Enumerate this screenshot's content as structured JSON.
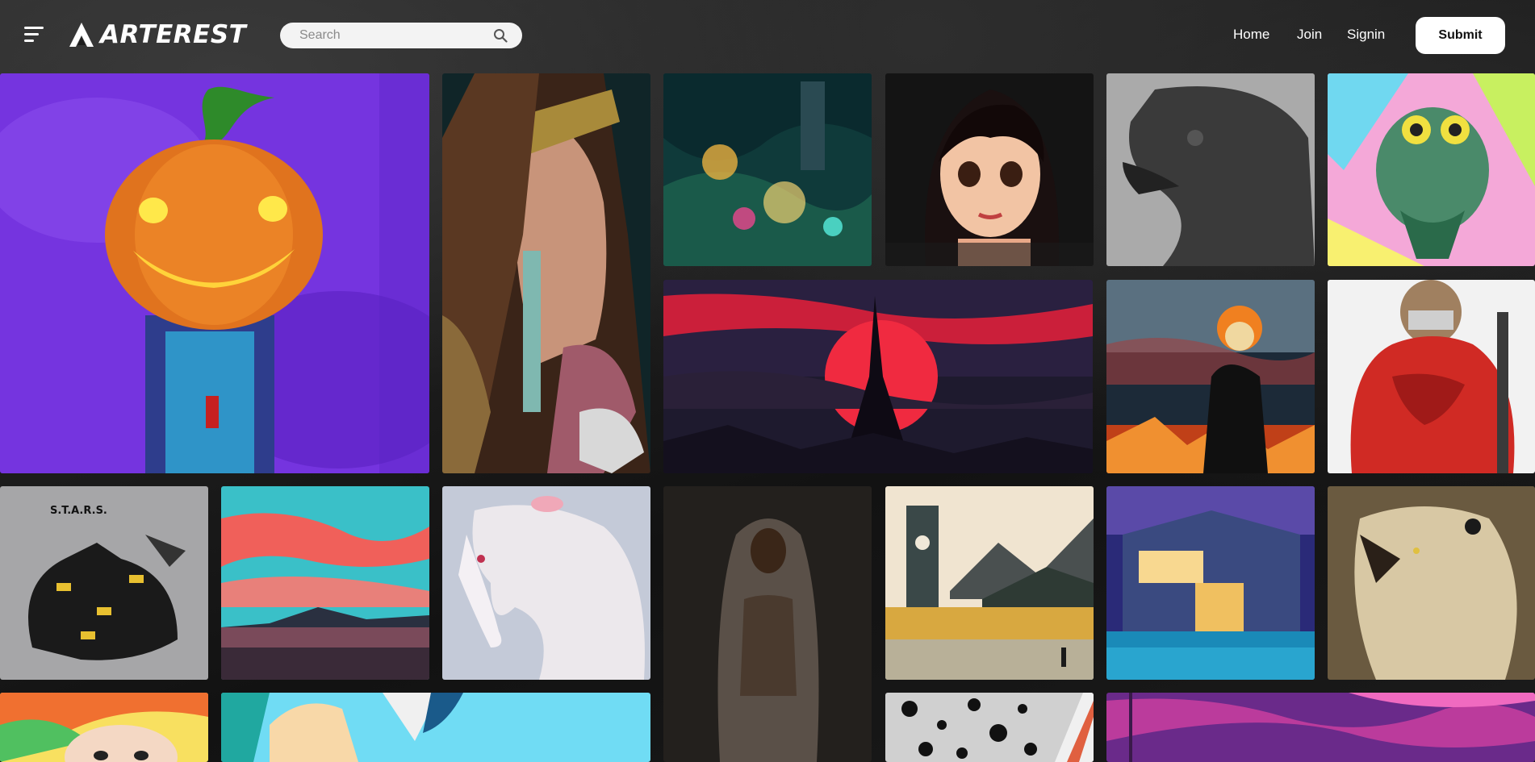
{
  "header": {
    "brand": "ARTEREST",
    "search_placeholder": "Search",
    "search_value": "",
    "nav": {
      "home": "Home",
      "join": "Join",
      "signin": "Signin"
    },
    "submit_label": "Submit"
  },
  "artworks": {
    "tile_10_label": "S.T.A.R.S."
  },
  "icons": [
    "menu-icon",
    "arterest-logo",
    "search-icon"
  ]
}
